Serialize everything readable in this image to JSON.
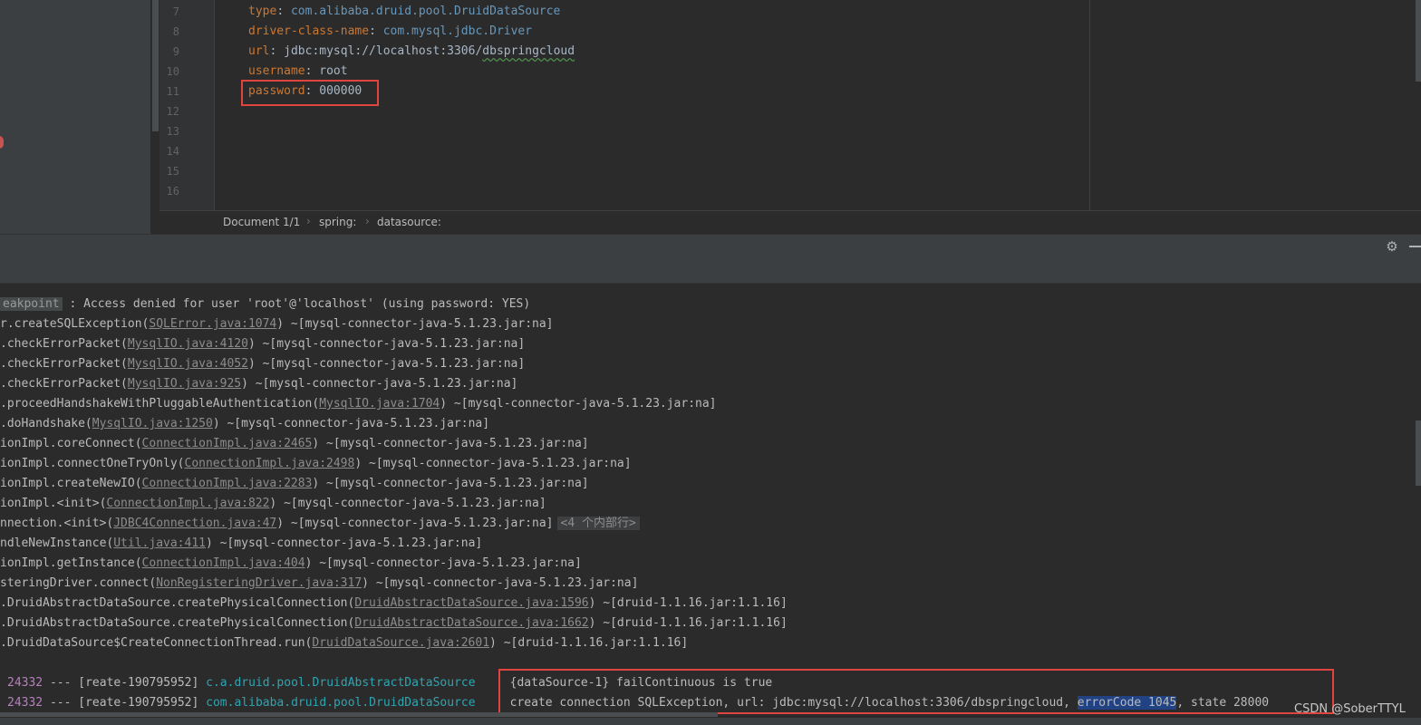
{
  "editor": {
    "line_numbers": [
      "7",
      "8",
      "9",
      "10",
      "11",
      "12",
      "13",
      "14",
      "15",
      "16"
    ],
    "lines": [
      {
        "key": "type",
        "sep": ": ",
        "value": "com.alibaba.druid.pool.DruidDataSource"
      },
      {
        "key": "driver-class-name",
        "sep": ": ",
        "value": "com.mysql.jdbc.Driver"
      },
      {
        "key": "url",
        "sep": ": ",
        "value_prefix": "jdbc:mysql://localhost:3306/",
        "value_underlined": "dbspringcloud"
      },
      {
        "key": "username",
        "sep": ": ",
        "value": "root"
      },
      {
        "key": "password",
        "sep": ": ",
        "value": "000000"
      }
    ]
  },
  "breadcrumb": {
    "items": [
      "Document 1/1",
      "spring:",
      "datasource:"
    ],
    "separator": "›"
  },
  "toolbar": {
    "gear_icon": "⚙"
  },
  "console": {
    "first_line": {
      "tag": "eakpoint",
      "text": " : Access denied for user 'root'@'localhost' (using password: YES)"
    },
    "stack": [
      {
        "pre": "r.createSQLException(",
        "link": "SQLError.java:1074",
        "post": ") ~[mysql-connector-java-5.1.23.jar:na]"
      },
      {
        "pre": ".checkErrorPacket(",
        "link": "MysqlIO.java:4120",
        "post": ") ~[mysql-connector-java-5.1.23.jar:na]"
      },
      {
        "pre": ".checkErrorPacket(",
        "link": "MysqlIO.java:4052",
        "post": ") ~[mysql-connector-java-5.1.23.jar:na]"
      },
      {
        "pre": ".checkErrorPacket(",
        "link": "MysqlIO.java:925",
        "post": ") ~[mysql-connector-java-5.1.23.jar:na]"
      },
      {
        "pre": ".proceedHandshakeWithPluggableAuthentication(",
        "link": "MysqlIO.java:1704",
        "post": ") ~[mysql-connector-java-5.1.23.jar:na]"
      },
      {
        "pre": ".doHandshake(",
        "link": "MysqlIO.java:1250",
        "post": ") ~[mysql-connector-java-5.1.23.jar:na]"
      },
      {
        "pre": "ionImpl.coreConnect(",
        "link": "ConnectionImpl.java:2465",
        "post": ") ~[mysql-connector-java-5.1.23.jar:na]"
      },
      {
        "pre": "ionImpl.connectOneTryOnly(",
        "link": "ConnectionImpl.java:2498",
        "post": ") ~[mysql-connector-java-5.1.23.jar:na]"
      },
      {
        "pre": "ionImpl.createNewIO(",
        "link": "ConnectionImpl.java:2283",
        "post": ") ~[mysql-connector-java-5.1.23.jar:na]"
      },
      {
        "pre": "ionImpl.<init>(",
        "link": "ConnectionImpl.java:822",
        "post": ") ~[mysql-connector-java-5.1.23.jar:na]"
      },
      {
        "pre": "nnection.<init>(",
        "link": "JDBC4Connection.java:47",
        "post": ") ~[mysql-connector-java-5.1.23.jar:na]",
        "folded": "<4 个内部行>"
      },
      {
        "pre": "ndleNewInstance(",
        "link": "Util.java:411",
        "post": ") ~[mysql-connector-java-5.1.23.jar:na]"
      },
      {
        "pre": "ionImpl.getInstance(",
        "link": "ConnectionImpl.java:404",
        "post": ") ~[mysql-connector-java-5.1.23.jar:na]"
      },
      {
        "pre": "steringDriver.connect(",
        "link": "NonRegisteringDriver.java:317",
        "post": ") ~[mysql-connector-java-5.1.23.jar:na]"
      },
      {
        "pre": ".DruidAbstractDataSource.createPhysicalConnection(",
        "link": "DruidAbstractDataSource.java:1596",
        "post": ") ~[druid-1.1.16.jar:1.1.16]"
      },
      {
        "pre": ".DruidAbstractDataSource.createPhysicalConnection(",
        "link": "DruidAbstractDataSource.java:1662",
        "post": ") ~[druid-1.1.16.jar:1.1.16]"
      },
      {
        "pre": ".DruidDataSource$CreateConnectionThread.run(",
        "link": "DruidDataSource.java:2601",
        "post": ") ~[druid-1.1.16.jar:1.1.16]"
      }
    ],
    "log_lines": [
      {
        "pid": "24332",
        "mid": " --- [reate-190795952] ",
        "logger": "c.a.druid.pool.DruidAbstractDataSource",
        "msg": " : {dataSource-1} failContinuous is true"
      },
      {
        "pid": "24332",
        "mid": " --- [reate-190795952] ",
        "logger": "com.alibaba.druid.pool.DruidDataSource",
        "msg": " : create connection SQLException, url: jdbc:mysql://localhost:3306/dbspringcloud, ",
        "selected": "errorCode 1045",
        "msg_tail": ", state 28000"
      }
    ]
  },
  "watermark": "CSDN @SoberTTYL"
}
